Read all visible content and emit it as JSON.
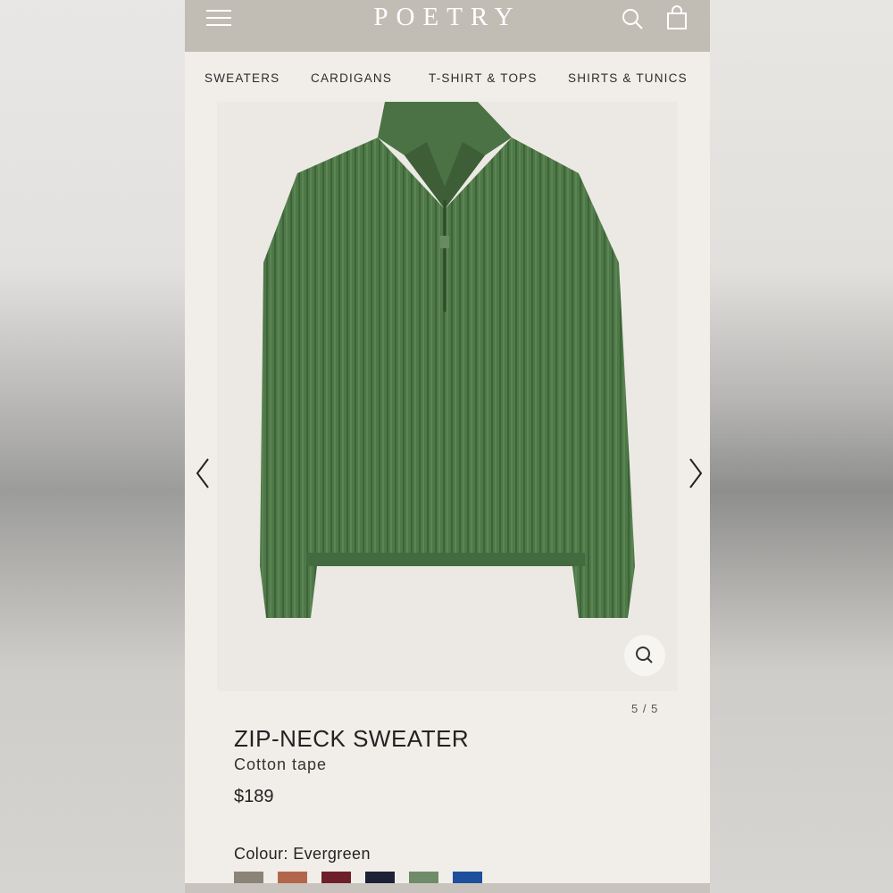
{
  "header": {
    "brand": "POETRY",
    "menu_icon": "hamburger-menu-icon",
    "search_icon": "search-icon",
    "bag_icon": "shopping-bag-icon"
  },
  "nav": {
    "items": [
      "SWEATERS",
      "CARDIGANS",
      "T-SHIRT & TOPS",
      "SHIRTS & TUNICS"
    ]
  },
  "gallery": {
    "image": "green-ribbed-zip-neck-sweater",
    "pager": "5 / 5",
    "prev_icon": "chevron-left-icon",
    "next_icon": "chevron-right-icon",
    "zoom_icon": "zoom-icon"
  },
  "product": {
    "title": "ZIP-NECK SWEATER",
    "subtitle": "Cotton tape",
    "price": "$189",
    "colour_label": "Colour: Evergreen",
    "swatches": [
      "#8a8377",
      "#b4664d",
      "#6d1f2a",
      "#1d2236",
      "#6f8c68",
      "#1d4f9c"
    ]
  },
  "colors": {
    "header_bg": "#c2bdb4",
    "page_bg": "#f1eeea",
    "sweater": "#4f7a4a"
  }
}
